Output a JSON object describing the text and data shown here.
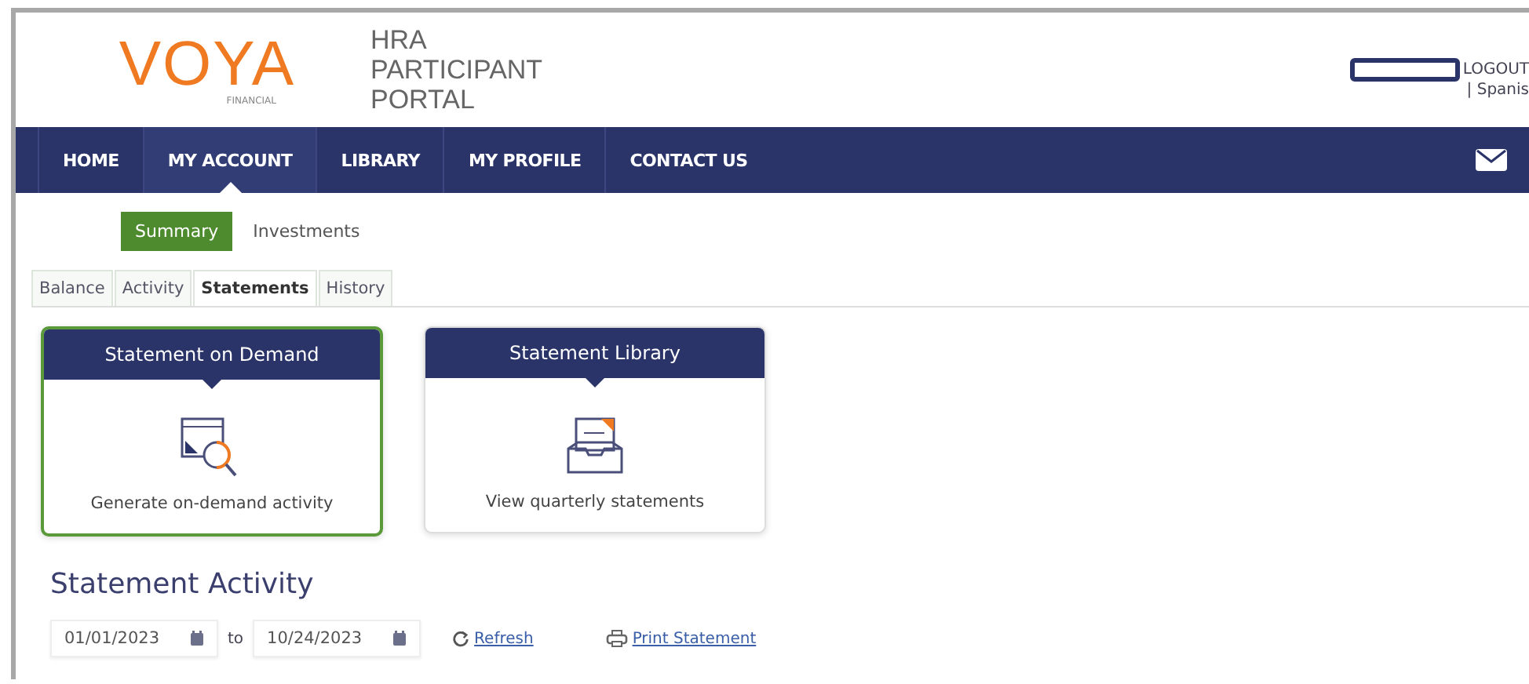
{
  "header": {
    "logo": "VOYA",
    "logo_sub": "FINANCIAL",
    "portal_title": [
      "HRA",
      "PARTICIPANT",
      "PORTAL"
    ],
    "logout": "LOGOUT",
    "language": "| Spanis"
  },
  "nav": [
    {
      "label": "HOME",
      "selected": false
    },
    {
      "label": "MY ACCOUNT",
      "selected": true
    },
    {
      "label": "LIBRARY",
      "selected": false
    },
    {
      "label": "MY PROFILE",
      "selected": false
    },
    {
      "label": "CONTACT US",
      "selected": false
    }
  ],
  "subtabs": [
    {
      "label": "Summary",
      "selected": true
    },
    {
      "label": "Investments",
      "selected": false
    }
  ],
  "tabs": [
    {
      "label": "Balance",
      "selected": false
    },
    {
      "label": "Activity",
      "selected": false
    },
    {
      "label": "Statements",
      "selected": true
    },
    {
      "label": "History",
      "selected": false
    }
  ],
  "cards": [
    {
      "kind": "demand",
      "title": "Statement on Demand",
      "text": "Generate on-demand activity",
      "selected": true
    },
    {
      "kind": "library",
      "title": "Statement Library",
      "text": "View quarterly statements",
      "selected": false
    }
  ],
  "statement_activity": {
    "heading": "Statement Activity",
    "from": "01/01/2023",
    "to_label": "to",
    "to": "10/24/2023",
    "refresh": "Refresh",
    "print": "Print Statement"
  }
}
